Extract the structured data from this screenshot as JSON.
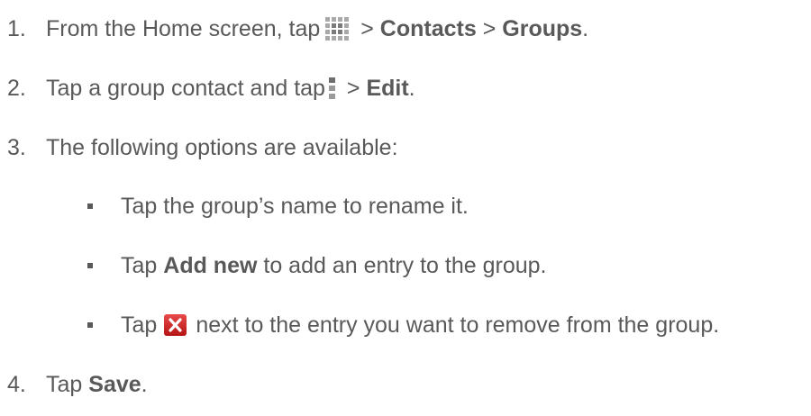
{
  "steps": [
    {
      "number": "1.",
      "prefix": "From the Home screen, tap",
      "sep1": " > ",
      "bold1": "Contacts",
      "sep2": " > ",
      "bold2": "Groups",
      "suffix": "."
    },
    {
      "number": "2.",
      "prefix": "Tap a group contact and tap",
      "sep1": " > ",
      "bold1": "Edit",
      "suffix": "."
    },
    {
      "number": "3.",
      "text": "The following options are available:"
    },
    {
      "number": "4.",
      "prefix": "Tap ",
      "bold1": "Save",
      "suffix": "."
    }
  ],
  "options": [
    {
      "text": "Tap the group’s name to rename it."
    },
    {
      "prefix": "Tap ",
      "bold": "Add new",
      "suffix": " to add an entry to the group."
    },
    {
      "prefix": "Tap",
      "suffix": "next to the entry you want to remove from the group."
    }
  ],
  "icons": {
    "apps": "apps-grid-icon",
    "menu": "menu-icon",
    "remove": "remove-icon",
    "remove_color": "#cc2222"
  }
}
